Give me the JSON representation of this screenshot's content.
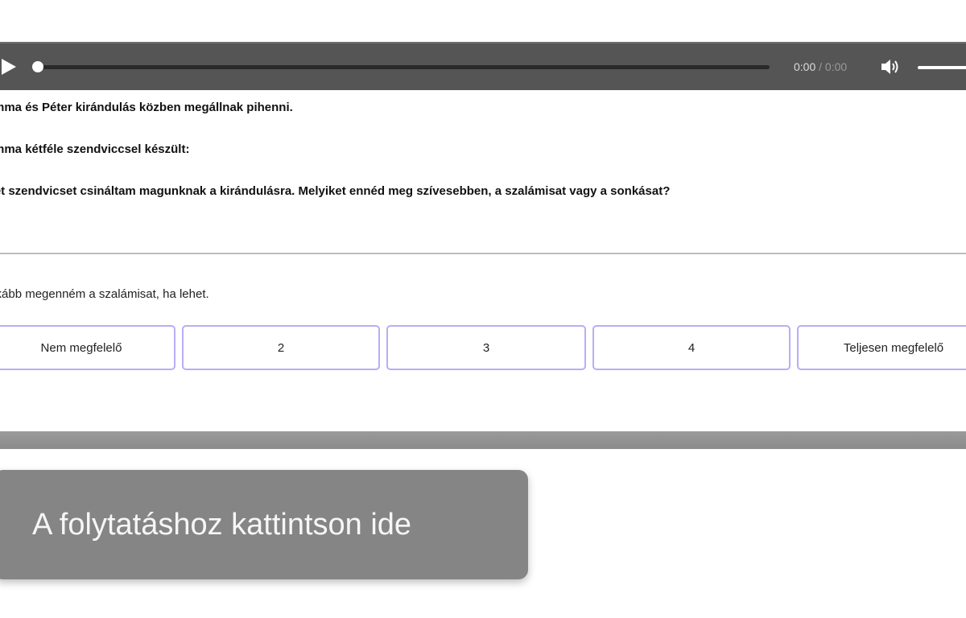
{
  "player": {
    "current_time": "0:00",
    "separator": "/",
    "duration": "0:00",
    "progress": 0,
    "volume": 1,
    "play_icon": "play-icon",
    "volume_icon": "speaker-icon"
  },
  "scenario": {
    "line1": "Emma és Péter kirándulás közben megállnak pihenni.",
    "line2": "Emma kétféle szendviccsel készült:",
    "line3": "Két szendvicset csináltam magunknak a kirándulásra. Melyiket ennéd meg szívesebben, a szalámisat vagy a sonkásat?"
  },
  "response": {
    "text": "Inkább megenném a szalámisat, ha lehet."
  },
  "rating": {
    "options": [
      "Nem megfelelő",
      "2",
      "3",
      "4",
      "Teljesen megfelelő"
    ]
  },
  "continue_button": {
    "label": "A folytatáshoz kattintson ide"
  },
  "colors": {
    "player_bg": "#555555",
    "option_border": "#b7aef7",
    "continue_bg": "#858585"
  }
}
